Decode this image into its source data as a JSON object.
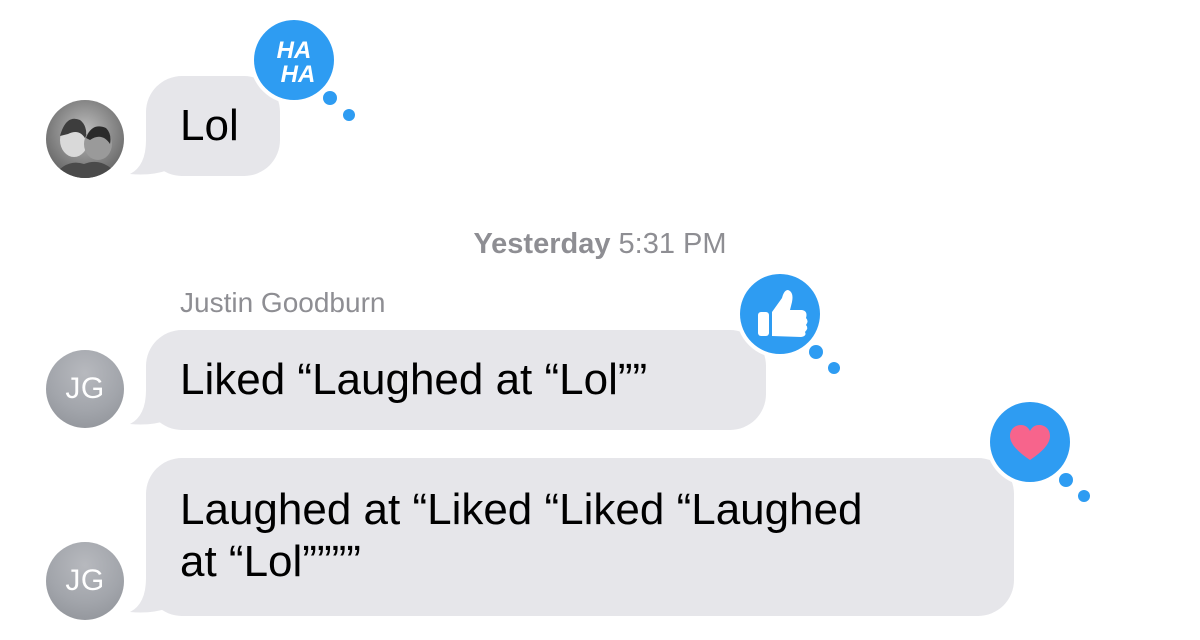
{
  "colors": {
    "bubble_gray": "#e6e6ea",
    "tapback_blue": "#2e9cf2",
    "heart_pink": "#f7648c",
    "meta_gray": "#8e8e93"
  },
  "timestamp": {
    "day": "Yesterday",
    "time": "5:31 PM"
  },
  "messages": [
    {
      "sender": "",
      "avatar": "photo",
      "text": "Lol",
      "tapback": {
        "icon": "haha-icon",
        "label": "HA HA"
      }
    },
    {
      "sender": "Justin Goodburn",
      "avatar_initials": "JG",
      "text": "Liked “Laughed at “Lol””",
      "tapback": {
        "icon": "thumbs-up-icon"
      }
    },
    {
      "sender": "",
      "avatar_initials": "JG",
      "text_line1": "Laughed at “Liked “Liked “Laughed",
      "text_line2": "at “Lol””””",
      "tapback": {
        "icon": "heart-icon"
      }
    }
  ]
}
